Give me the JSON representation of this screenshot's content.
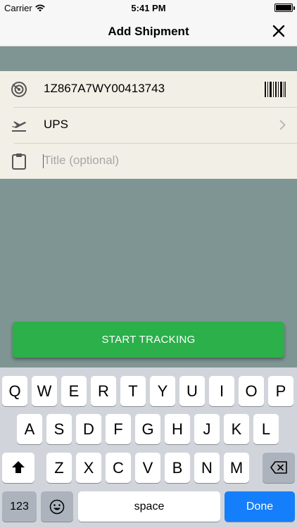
{
  "status_bar": {
    "carrier": "Carrier",
    "time": "5:41 PM"
  },
  "nav": {
    "title": "Add Shipment",
    "close_icon": "close-icon"
  },
  "form": {
    "tracking_number": "1Z867A7WY00413743",
    "carrier": "UPS",
    "title_placeholder": "Title (optional)"
  },
  "button": {
    "start_tracking": "START TRACKING"
  },
  "keyboard": {
    "row1": [
      "Q",
      "W",
      "E",
      "R",
      "T",
      "Y",
      "U",
      "I",
      "O",
      "P"
    ],
    "row2": [
      "A",
      "S",
      "D",
      "F",
      "G",
      "H",
      "J",
      "K",
      "L"
    ],
    "row3": [
      "Z",
      "X",
      "C",
      "V",
      "B",
      "N",
      "M"
    ],
    "numbers": "123",
    "space": "space",
    "done": "Done"
  },
  "colors": {
    "accent_green": "#2bb04a",
    "background": "#7f9593",
    "card": "#f2efe6",
    "done_blue": "#157efb"
  }
}
